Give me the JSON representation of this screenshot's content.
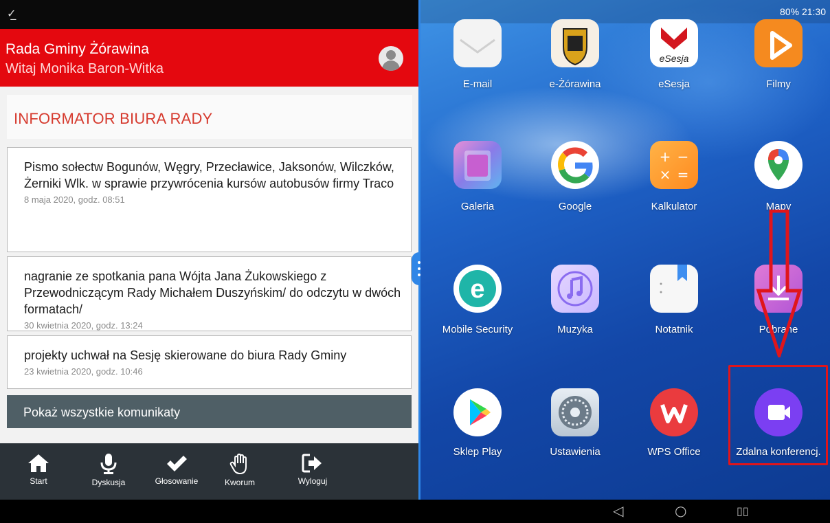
{
  "left_status": {
    "notification_icon": "download-done-icon"
  },
  "header": {
    "org_name": "Rada Gminy Żórawina",
    "greeting": "Witaj Monika Baron-Witka",
    "avatar_icon": "user-avatar-icon"
  },
  "informator": {
    "title": "INFORMATOR BIURA RADY",
    "items": [
      {
        "text": "Pismo sołectw Bogunów, Węgry, Przecławice, Jaksonów, Wilczków, Żerniki Wlk. w sprawie przywrócenia kursów autobusów firmy Traco",
        "date": "8 maja 2020, godz. 08:51"
      },
      {
        "text": "nagranie ze spotkania pana Wójta Jana Żukowskiego z Przewodniczącym Rady Michałem Duszyńskim/ do odczytu w dwóch formatach/",
        "date": "30 kwietnia 2020, godz. 13:24"
      },
      {
        "text": "projekty uchwał na Sesję skierowane do biura Rady Gminy",
        "date": "23 kwietnia 2020, godz. 10:46"
      }
    ],
    "show_all": "Pokaż wszystkie komunikaty"
  },
  "bottom_nav": [
    {
      "label": "Start",
      "icon": "home-icon"
    },
    {
      "label": "Dyskusja",
      "icon": "microphone-icon"
    },
    {
      "label": "Głosowanie",
      "icon": "checkmark-icon"
    },
    {
      "label": "Kworum",
      "icon": "hand-icon"
    },
    {
      "label": "Wyloguj",
      "icon": "logout-icon"
    }
  ],
  "right_status": {
    "text": "80%  21:30"
  },
  "apps": [
    {
      "label": "E-mail",
      "icon": "email-icon"
    },
    {
      "label": "e-Żórawina",
      "icon": "coat-of-arms-icon"
    },
    {
      "label": "eSesja",
      "icon": "esesja-icon"
    },
    {
      "label": "Filmy",
      "icon": "play-icon"
    },
    {
      "label": "Galeria",
      "icon": "gallery-icon"
    },
    {
      "label": "Google",
      "icon": "google-icon"
    },
    {
      "label": "Kalkulator",
      "icon": "calculator-icon"
    },
    {
      "label": "Mapy",
      "icon": "maps-pin-icon"
    },
    {
      "label": "Mobile Security",
      "icon": "eset-icon"
    },
    {
      "label": "Muzyka",
      "icon": "music-note-icon"
    },
    {
      "label": "Notatnik",
      "icon": "notepad-icon"
    },
    {
      "label": "Pobrane",
      "icon": "download-icon"
    },
    {
      "label": "Sklep Play",
      "icon": "play-store-icon"
    },
    {
      "label": "Ustawienia",
      "icon": "settings-gear-icon"
    },
    {
      "label": "WPS Office",
      "icon": "wps-office-icon"
    },
    {
      "label": "Zdalna konferencj.",
      "icon": "video-camera-icon"
    }
  ],
  "esesja_icon_text": "eSesja",
  "system_bar": {
    "back": "◁",
    "home": "○",
    "recents": "▯▯"
  },
  "colors": {
    "header_red": "#e4080f",
    "nav_dark": "#2b3238",
    "button_slate": "#4f5f66",
    "accent_blue": "#2f86e7",
    "annotation_red": "#e0151b"
  }
}
